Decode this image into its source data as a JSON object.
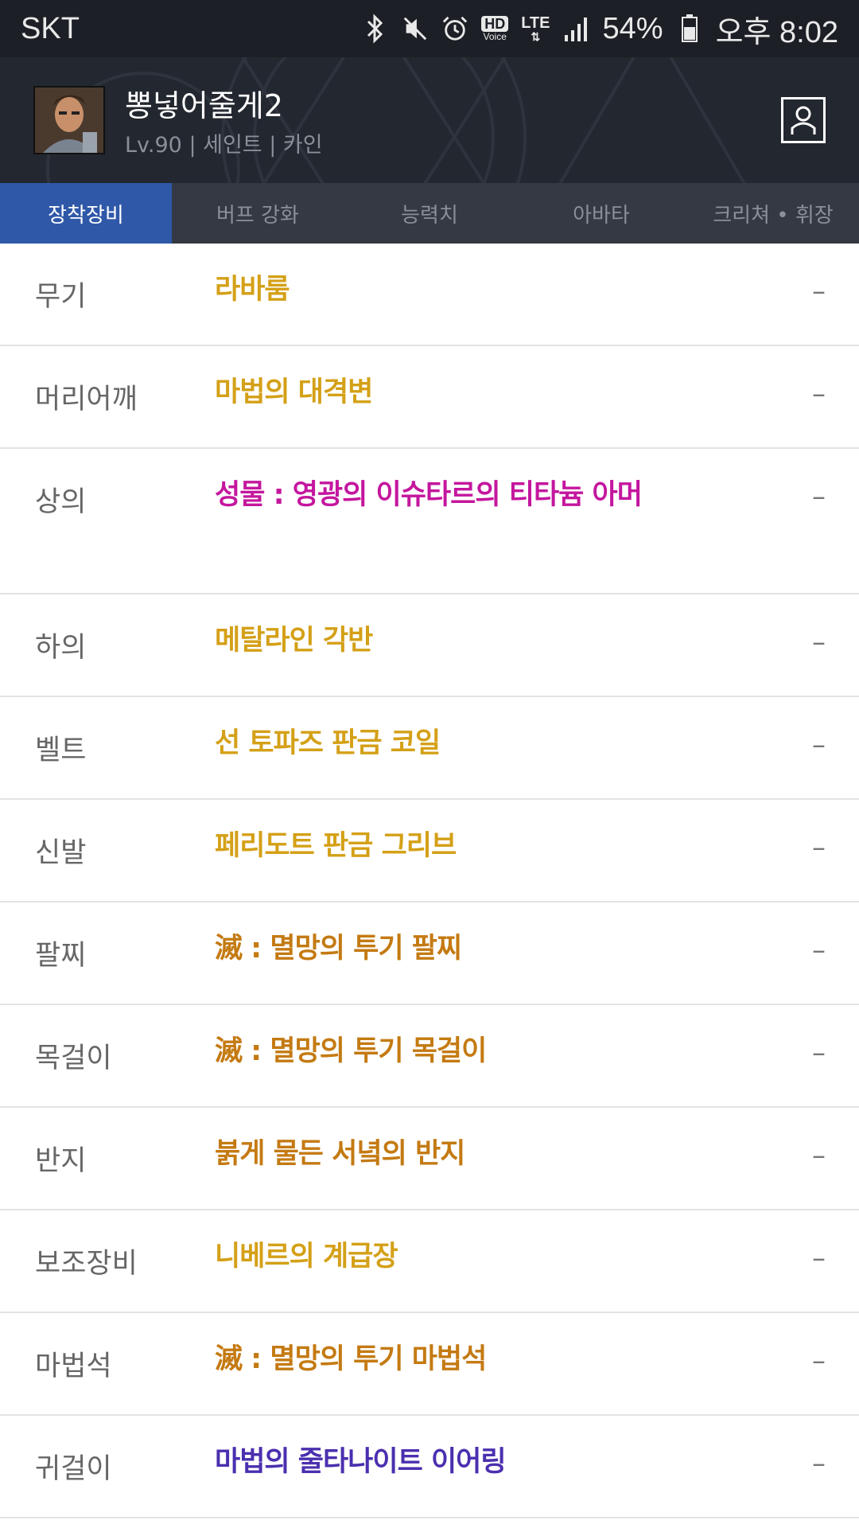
{
  "status_bar": {
    "carrier": "SKT",
    "icons": [
      "bluetooth-icon",
      "mute-icon",
      "alarm-icon",
      "hd-voice-icon",
      "lte-icon",
      "signal-icon",
      "battery-icon"
    ],
    "hd": "HD",
    "voice": "Voice",
    "lte": "LTE",
    "battery": "54%",
    "time": "오후 8:02"
  },
  "header": {
    "name": "뽕넣어줄게2",
    "info": "Lv.90 | 세인트 | 카인"
  },
  "tabs": [
    {
      "label": "장착장비",
      "active": true
    },
    {
      "label": "버프 강화",
      "active": false
    },
    {
      "label": "능력치",
      "active": false
    },
    {
      "label": "아바타",
      "active": false
    },
    {
      "label": "크리쳐 • 휘장",
      "active": false
    }
  ],
  "colors": {
    "unique": "#d4a017",
    "epic_set": "#c4169e",
    "legendary": "#c47a12",
    "rare": "#4b2faf",
    "active_tab": "#2f58a8"
  },
  "equipment": [
    {
      "slot": "무기",
      "item": "라바룸",
      "grade": "unique",
      "extra": "–"
    },
    {
      "slot": "머리어깨",
      "item": "마법의 대격변",
      "grade": "unique",
      "extra": "–"
    },
    {
      "slot": "상의",
      "item": "성물 : 영광의 이슈타르의 티타늄 아머",
      "grade": "epic_set",
      "extra": "–"
    },
    {
      "slot": "하의",
      "item": "메탈라인 각반",
      "grade": "unique",
      "extra": "–"
    },
    {
      "slot": "벨트",
      "item": "선 토파즈 판금 코일",
      "grade": "unique",
      "extra": "–"
    },
    {
      "slot": "신발",
      "item": "페리도트 판금 그리브",
      "grade": "unique",
      "extra": "–"
    },
    {
      "slot": "팔찌",
      "item": "滅 : 멸망의 투기 팔찌",
      "grade": "legendary",
      "extra": "–"
    },
    {
      "slot": "목걸이",
      "item": "滅 : 멸망의 투기 목걸이",
      "grade": "legendary",
      "extra": "–"
    },
    {
      "slot": "반지",
      "item": "붉게 물든 서녘의 반지",
      "grade": "legendary",
      "extra": "–"
    },
    {
      "slot": "보조장비",
      "item": "니베르의 계급장",
      "grade": "unique",
      "extra": "–"
    },
    {
      "slot": "마법석",
      "item": "滅 : 멸망의 투기 마법석",
      "grade": "legendary",
      "extra": "–"
    },
    {
      "slot": "귀걸이",
      "item": "마법의 줄타나이트 이어링",
      "grade": "rare",
      "extra": "–"
    }
  ]
}
